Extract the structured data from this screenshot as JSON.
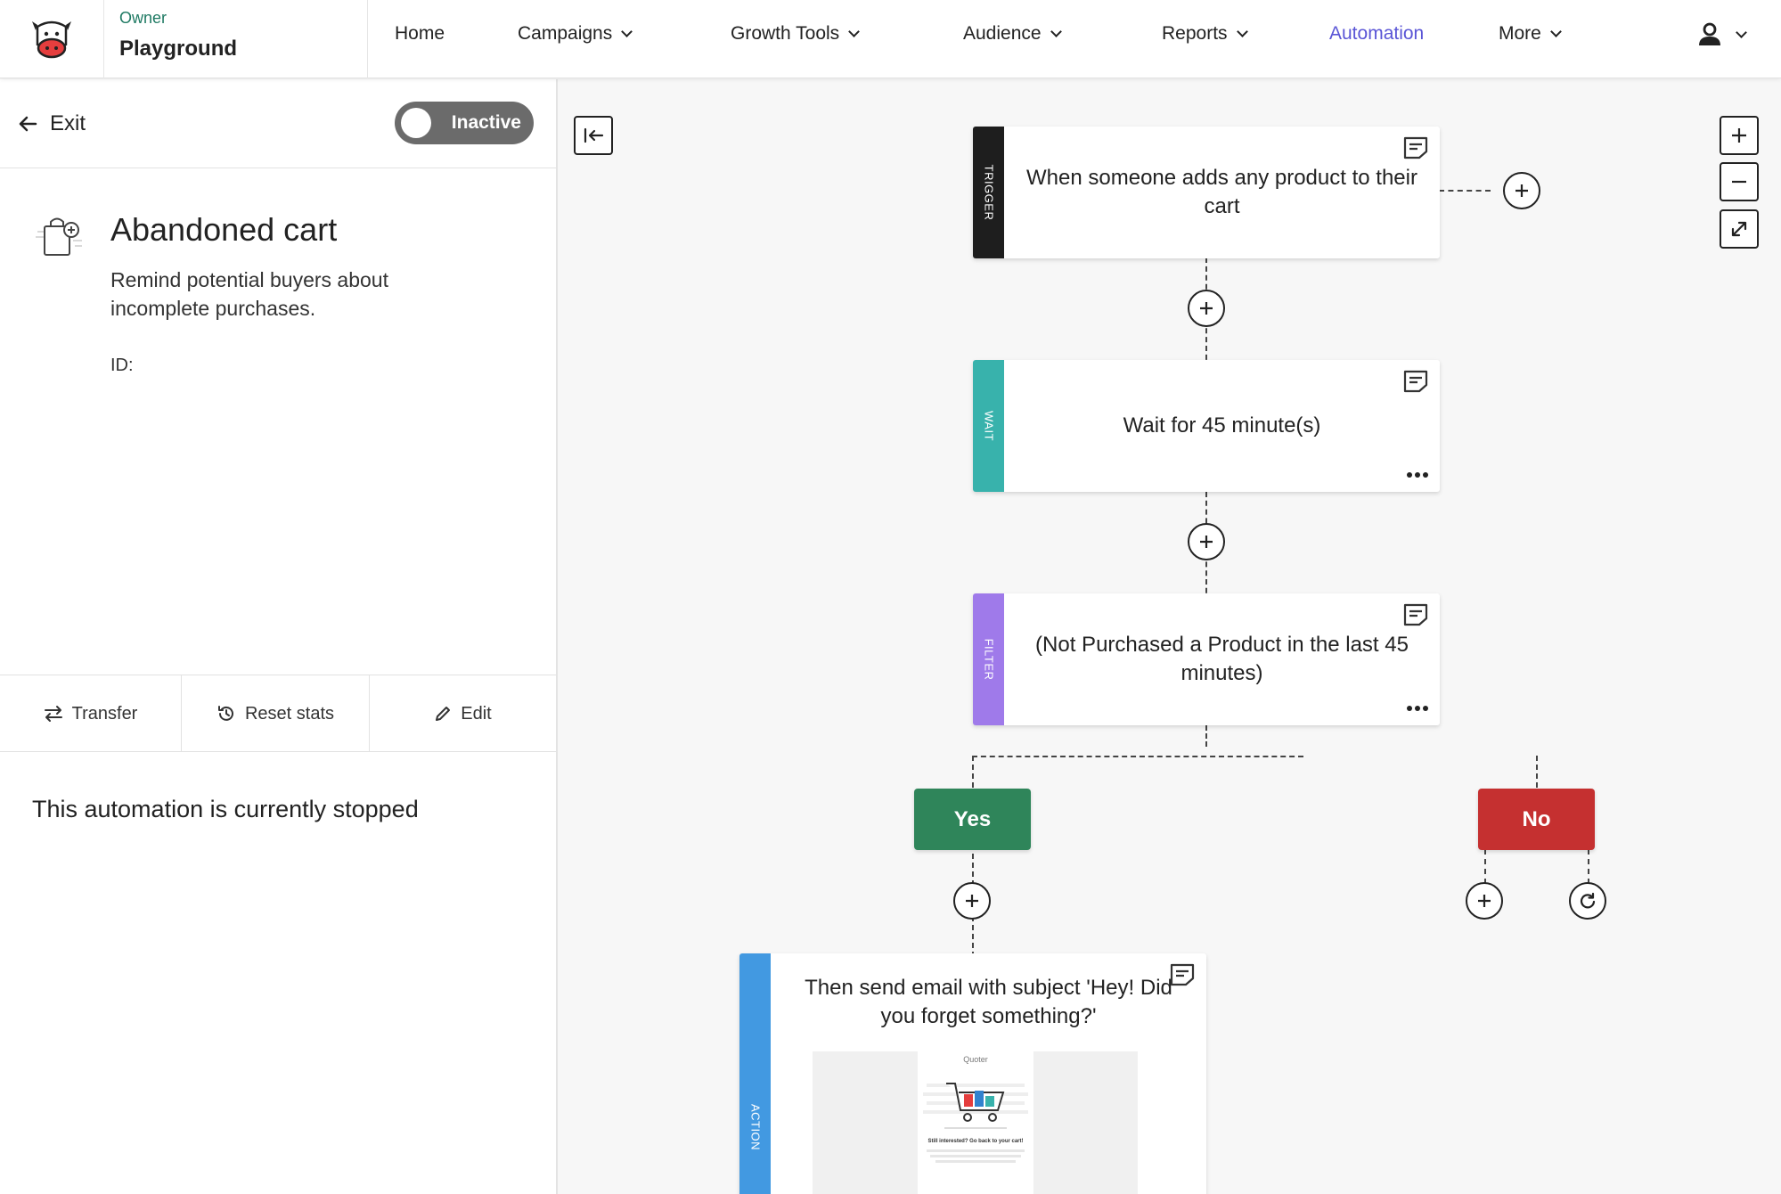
{
  "header": {
    "org_role": "Owner",
    "org_name": "Playground",
    "nav": [
      {
        "label": "Home",
        "dropdown": false
      },
      {
        "label": "Campaigns",
        "dropdown": true
      },
      {
        "label": "Growth Tools",
        "dropdown": true
      },
      {
        "label": "Audience",
        "dropdown": true
      },
      {
        "label": "Reports",
        "dropdown": true
      },
      {
        "label": "Automation",
        "dropdown": false,
        "active": true
      },
      {
        "label": "More",
        "dropdown": true
      }
    ]
  },
  "sidebar": {
    "exit_label": "Exit",
    "status_toggle": {
      "label": "Inactive",
      "on": false
    },
    "automation": {
      "title": "Abandoned cart",
      "description": "Remind potential buyers about incomplete purchases.",
      "id_label": "ID:"
    },
    "actions": {
      "transfer": "Transfer",
      "reset_stats": "Reset stats",
      "edit": "Edit"
    },
    "status_message": "This automation is currently stopped"
  },
  "workflow": {
    "trigger": {
      "type_label": "TRIGGER",
      "text": "When someone adds any product to their cart"
    },
    "wait": {
      "type_label": "WAIT",
      "text": "Wait for 45 minute(s)"
    },
    "filter": {
      "type_label": "FILTER",
      "text": "(Not Purchased a Product in the last 45 minutes)"
    },
    "branches": {
      "yes": "Yes",
      "no": "No"
    },
    "action": {
      "type_label": "ACTION",
      "text": "Then send email with subject 'Hey! Did you forget something?'",
      "preview": {
        "brand": "Quoter",
        "headline": "Still interested? Go back to your cart!"
      }
    }
  },
  "colors": {
    "accent": "#5a55d6",
    "org_role": "#1f7a63",
    "trigger": "#1e1e1e",
    "wait": "#38b2ac",
    "filter": "#9f7aea",
    "action": "#4299e1",
    "yes": "#2f855a",
    "no": "#c53030",
    "toggle_off": "#6b6b6b"
  }
}
